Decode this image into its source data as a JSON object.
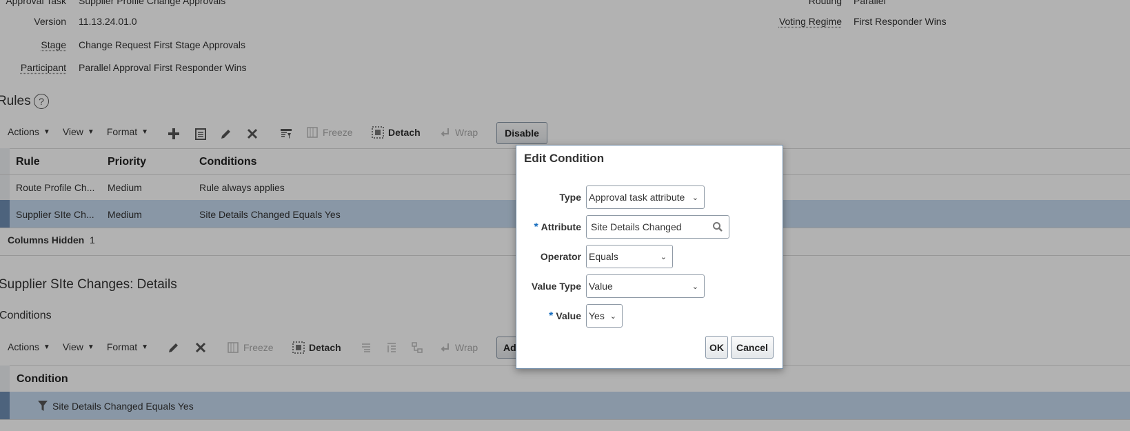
{
  "header": {
    "approval_task_label": "Approval Task",
    "approval_task_value": "Supplier Profile Change Approvals",
    "routing_label": "Routing",
    "routing_value": "Parallel",
    "version_label": "Version",
    "version_value": "11.13.24.01.0",
    "voting_label": "Voting Regime",
    "voting_value": "First Responder Wins",
    "stage_label": "Stage",
    "stage_value": "Change Request First Stage Approvals",
    "participant_label": "Participant",
    "participant_value": "Parallel Approval First Responder Wins"
  },
  "rules": {
    "title": "Rules",
    "toolbar": {
      "actions": "Actions",
      "view": "View",
      "format": "Format",
      "freeze": "Freeze",
      "detach": "Detach",
      "wrap": "Wrap",
      "disable": "Disable"
    },
    "columns": [
      "Rule",
      "Priority",
      "Conditions"
    ],
    "rows": [
      {
        "rule": "Route Profile Ch...",
        "priority": "Medium",
        "conditions": "Rule always applies"
      },
      {
        "rule": "Supplier SIte Ch...",
        "priority": "Medium",
        "conditions": "Site Details Changed Equals Yes"
      }
    ],
    "columns_hidden_label": "Columns Hidden",
    "columns_hidden_count": "1"
  },
  "details": {
    "title": "Supplier SIte Changes: Details",
    "conditions_title": "Conditions",
    "toolbar": {
      "actions": "Actions",
      "view": "View",
      "format": "Format",
      "freeze": "Freeze",
      "detach": "Detach",
      "wrap": "Wrap",
      "add": "Ad"
    },
    "column": "Condition",
    "row": "Site Details Changed Equals Yes"
  },
  "dialog": {
    "title": "Edit Condition",
    "type_label": "Type",
    "type_value": "Approval task attribute",
    "attribute_label": "Attribute",
    "attribute_value": "Site Details Changed",
    "operator_label": "Operator",
    "operator_value": "Equals",
    "value_type_label": "Value Type",
    "value_type_value": "Value",
    "value_label": "Value",
    "value_value": "Yes",
    "required_mark": "*",
    "ok": "OK",
    "cancel": "Cancel"
  },
  "colors": {
    "selected_row": "#c5d9ee",
    "required": "#1a6fbf",
    "dialog_border": "#6e8aa6"
  }
}
